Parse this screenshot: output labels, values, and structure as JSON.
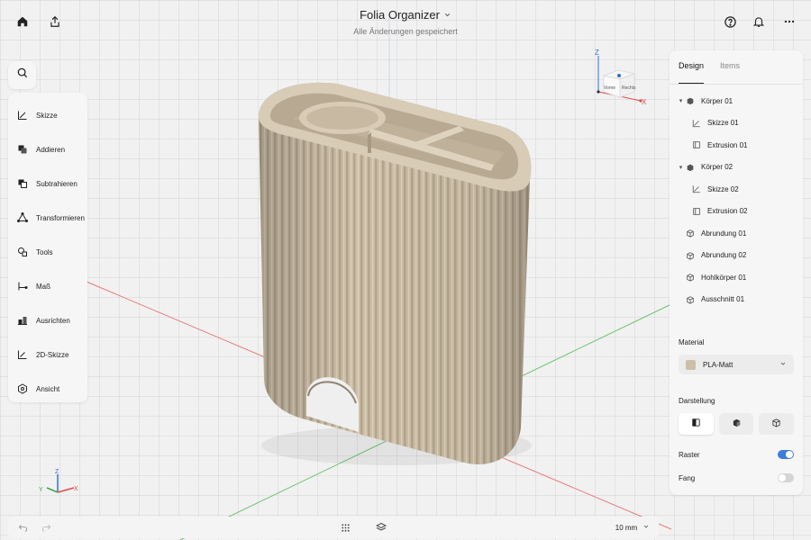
{
  "app": {
    "title": "Folia Organizer",
    "subtitle": "Alle Änderungen gespeichert"
  },
  "toolbar_top": {
    "left_icons": [
      "home-icon",
      "share-icon"
    ],
    "right_icons": [
      "help-icon",
      "bell-icon",
      "more-icon"
    ]
  },
  "tools": [
    {
      "label": "Skizze",
      "icon": "sketch-icon"
    },
    {
      "label": "Addieren",
      "icon": "add-icon"
    },
    {
      "label": "Subtrahieren",
      "icon": "subtract-icon"
    },
    {
      "label": "Transformieren",
      "icon": "transform-icon"
    },
    {
      "label": "Tools",
      "icon": "tools-icon"
    },
    {
      "label": "Maß",
      "icon": "measure-icon"
    },
    {
      "label": "Ausrichten",
      "icon": "align-icon"
    },
    {
      "label": "2D-Skizze",
      "icon": "sketch2d-icon"
    },
    {
      "label": "Ansicht",
      "icon": "view-icon"
    }
  ],
  "panel": {
    "tabs": [
      {
        "label": "Design",
        "active": true
      },
      {
        "label": "Items",
        "active": false
      }
    ],
    "tree": [
      {
        "label": "Körper 01",
        "type": "body",
        "level": 0,
        "expandable": true
      },
      {
        "label": "Skizze 01",
        "type": "sketch",
        "level": 1
      },
      {
        "label": "Extrusion 01",
        "type": "extrusion",
        "level": 1
      },
      {
        "label": "Körper 02",
        "type": "body",
        "level": 0,
        "expandable": true
      },
      {
        "label": "Skizze 02",
        "type": "sketch",
        "level": 1
      },
      {
        "label": "Extrusion 02",
        "type": "extrusion",
        "level": 1
      },
      {
        "label": "Abrundung 01",
        "type": "feature",
        "level": 0
      },
      {
        "label": "Abrundung 02",
        "type": "feature",
        "level": 0
      },
      {
        "label": "Hohlkörper 01",
        "type": "feature",
        "level": 0
      },
      {
        "label": "Ausschnitt 01",
        "type": "feature",
        "level": 0
      }
    ],
    "material_label": "Material",
    "material_value": "PLA-Matt",
    "material_color": "#cdbfa8",
    "display_label": "Darstellung",
    "display_modes": [
      "solid-icon",
      "shaded-icon",
      "wireframe-icon"
    ],
    "display_active": 0,
    "raster_label": "Raster",
    "raster_on": true,
    "snap_label": "Fang",
    "snap_on": false,
    "accent": "#3b7fd9"
  },
  "viewcube": {
    "front": "Vorne",
    "right": "Rechts",
    "x": "X",
    "z": "Z"
  },
  "axis_gizmo": {
    "x": "X",
    "y": "Y",
    "z": "Z"
  },
  "bottom": {
    "units": "10 mm"
  },
  "colors": {
    "object": "#cdbfa8",
    "x_axis": "#e34b4b",
    "y_axis": "#3aa84a",
    "z_axis": "#2f6fd6"
  }
}
